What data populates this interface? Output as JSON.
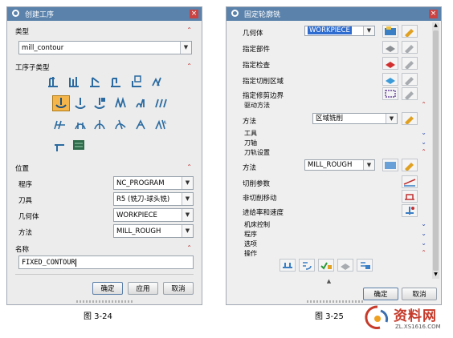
{
  "left_dialog": {
    "title": "创建工序",
    "close": "×",
    "type_section": "类型",
    "type_value": "mill_contour",
    "subtype_section": "工序子类型",
    "location_section": "位置",
    "rows": [
      {
        "label": "程序",
        "value": "NC_PROGRAM"
      },
      {
        "label": "刀具",
        "value": "R5 (铣刀-球头铣)"
      },
      {
        "label": "几何体",
        "value": "WORKPIECE"
      },
      {
        "label": "方法",
        "value": "MILL_ROUGH"
      }
    ],
    "name_section": "名称",
    "name_value": "FIXED_CONTOUR",
    "ok": "确定",
    "apply": "应用",
    "cancel": "取消"
  },
  "right_dialog": {
    "title": "固定轮廓铣",
    "close": "×",
    "geometry_label": "几何体",
    "geometry_value": "WORKPIECE",
    "part": "指定部件",
    "check": "指定检查",
    "cut_area": "指定切削区域",
    "trim": "指定修剪边界",
    "drive_section": "驱动方法",
    "drive_label": "方法",
    "drive_value": "区域铣削",
    "tool_section": "工具",
    "axis_section": "刀轴",
    "path_section": "刀轨设置",
    "path_method_label": "方法",
    "path_method_value": "MILL_ROUGH",
    "cut_params": "切削参数",
    "non_cut": "非切削移动",
    "feeds": "进给率和速度",
    "machine": "机床控制",
    "program": "程序",
    "options": "选项",
    "actions": "操作",
    "ok": "确定",
    "cancel": "取消"
  },
  "captions": {
    "left": "图 3-24",
    "right": "图 3-25"
  },
  "watermark": {
    "brand": "资料网",
    "url": "ZL.XS1616.COM"
  }
}
